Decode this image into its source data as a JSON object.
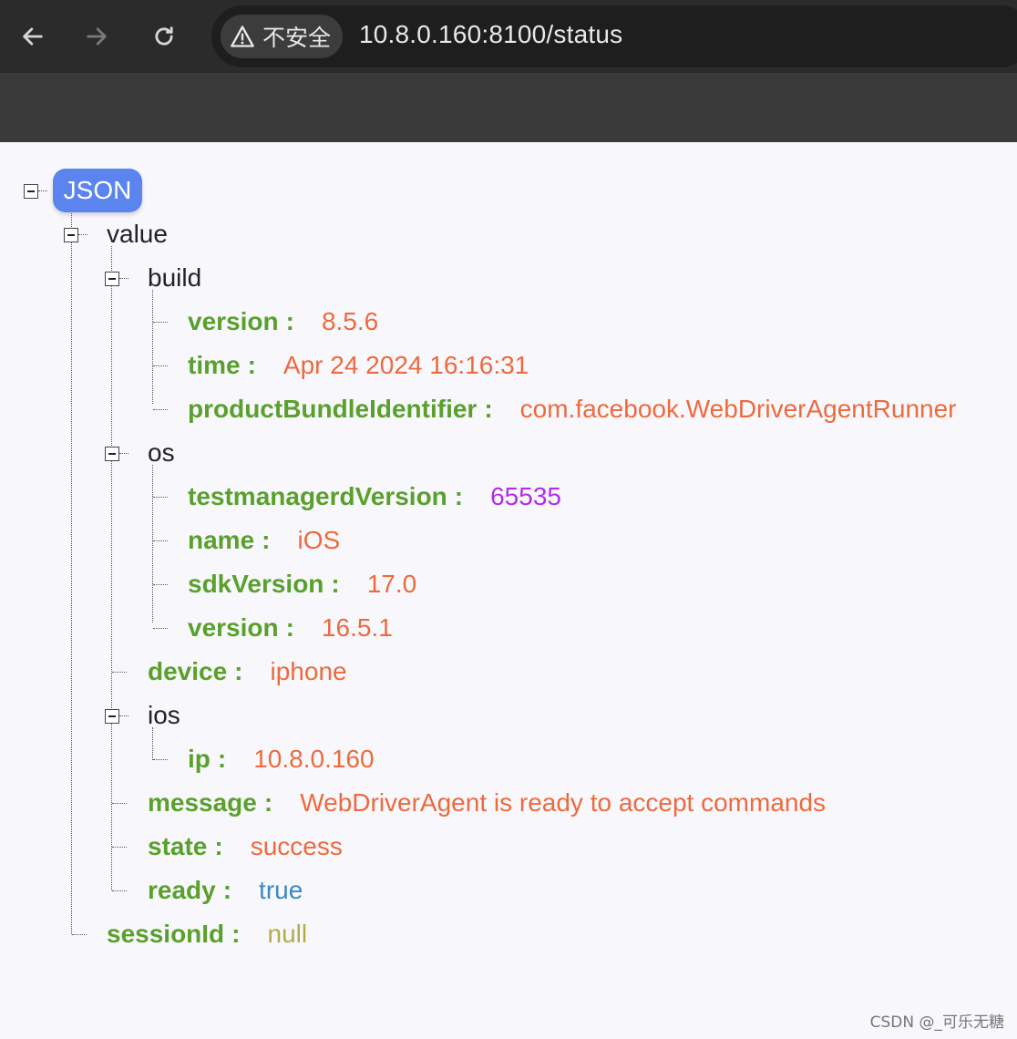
{
  "browser": {
    "security_label": "不安全",
    "url": "10.8.0.160:8100/status"
  },
  "tree": {
    "root_label": "JSON",
    "value_label": "value",
    "build_label": "build",
    "build": {
      "version_key": "version",
      "version_val": "8.5.6",
      "time_key": "time",
      "time_val": "Apr 24 2024 16:16:31",
      "bundle_key": "productBundleIdentifier",
      "bundle_val": "com.facebook.WebDriverAgentRunner"
    },
    "os_label": "os",
    "os": {
      "tmv_key": "testmanagerdVersion",
      "tmv_val": "65535",
      "name_key": "name",
      "name_val": "iOS",
      "sdk_key": "sdkVersion",
      "sdk_val": "17.0",
      "version_key": "version",
      "version_val": "16.5.1"
    },
    "device_key": "device",
    "device_val": "iphone",
    "ios_label": "ios",
    "ios": {
      "ip_key": "ip",
      "ip_val": "10.8.0.160"
    },
    "message_key": "message",
    "message_val": "WebDriverAgent is ready to accept commands",
    "state_key": "state",
    "state_val": "success",
    "ready_key": "ready",
    "ready_val": "true",
    "session_key": "sessionId",
    "session_val": "null",
    "colon": ":"
  },
  "watermark": "CSDN @_可乐无糖"
}
